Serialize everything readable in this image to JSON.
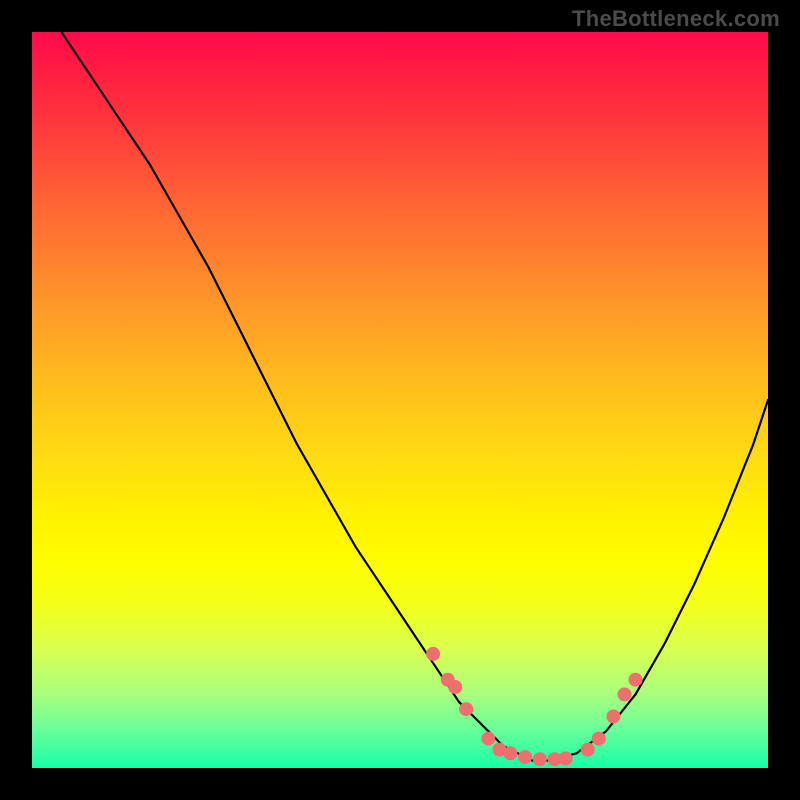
{
  "watermark": "TheBottleneck.com",
  "chart_data": {
    "type": "line",
    "title": "",
    "xlabel": "",
    "ylabel": "",
    "xlim": [
      0,
      100
    ],
    "ylim": [
      0,
      100
    ],
    "grid": false,
    "legend": false,
    "series": [
      {
        "name": "bottleneck-curve",
        "x": [
          4,
          8,
          12,
          16,
          20,
          24,
          28,
          32,
          36,
          40,
          44,
          48,
          52,
          56,
          58,
          60,
          62,
          64,
          66,
          68,
          70,
          74,
          78,
          82,
          86,
          90,
          94,
          98,
          100
        ],
        "y": [
          100,
          94,
          88,
          82,
          75,
          68,
          60,
          52,
          44,
          37,
          30,
          24,
          18,
          12,
          9,
          7,
          5,
          3,
          2,
          1,
          1,
          2,
          5,
          10,
          17,
          25,
          34,
          44,
          50
        ]
      }
    ],
    "highlight_points": {
      "name": "neck-dots",
      "x": [
        54.5,
        56.5,
        57.5,
        59.0,
        62.0,
        63.5,
        65.0,
        67.0,
        69.0,
        71.0,
        72.5,
        75.5,
        77.0,
        79.0,
        80.5,
        82.0
      ],
      "y": [
        15.5,
        12.0,
        11.0,
        8.0,
        4.0,
        2.5,
        2.0,
        1.5,
        1.2,
        1.2,
        1.3,
        2.5,
        4.0,
        7.0,
        10.0,
        12.0
      ]
    },
    "gradient_stops": [
      {
        "pos": 0.0,
        "color": "#ff0a4a"
      },
      {
        "pos": 0.1,
        "color": "#ff2e3e"
      },
      {
        "pos": 0.22,
        "color": "#ff5f35"
      },
      {
        "pos": 0.34,
        "color": "#ff8c2c"
      },
      {
        "pos": 0.46,
        "color": "#ffb71f"
      },
      {
        "pos": 0.58,
        "color": "#ffdc12"
      },
      {
        "pos": 0.66,
        "color": "#fff200"
      },
      {
        "pos": 0.72,
        "color": "#fffd00"
      },
      {
        "pos": 0.78,
        "color": "#f3ff1a"
      },
      {
        "pos": 0.84,
        "color": "#d8ff52"
      },
      {
        "pos": 0.9,
        "color": "#a8ff7e"
      },
      {
        "pos": 0.95,
        "color": "#66ff9b"
      },
      {
        "pos": 1.0,
        "color": "#17ffa6"
      }
    ],
    "dot_color": "#ef6f6f"
  }
}
